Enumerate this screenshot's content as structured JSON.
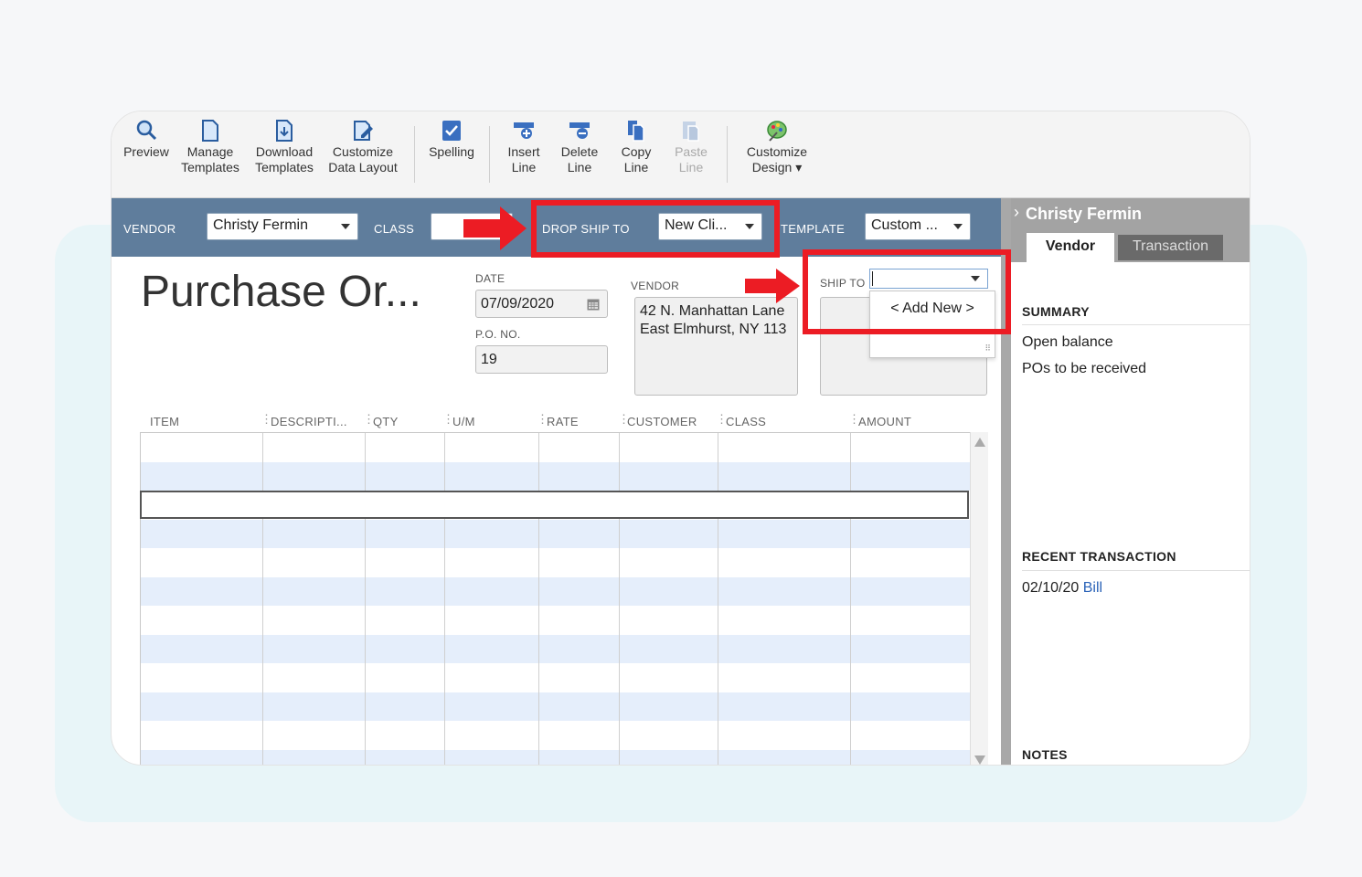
{
  "toolbar": {
    "preview": "Preview",
    "manage_1": "Manage",
    "manage_2": "Templates",
    "download_1": "Download",
    "download_2": "Templates",
    "customize_layout_1": "Customize",
    "customize_layout_2": "Data Layout",
    "spelling": "Spelling",
    "insert_1": "Insert",
    "insert_2": "Line",
    "delete_1": "Delete",
    "delete_2": "Line",
    "copy_1": "Copy",
    "copy_2": "Line",
    "paste_1": "Paste",
    "paste_2": "Line",
    "design_1": "Customize",
    "design_2": "Design ▾"
  },
  "header": {
    "vendor_label": "VENDOR",
    "vendor_value": "Christy Fermin",
    "class_label": "CLASS",
    "class_value": "",
    "drop_ship_label": "DROP SHIP TO",
    "drop_ship_value": "New Cli...",
    "template_label": "TEMPLATE",
    "template_value": "Custom ..."
  },
  "form": {
    "title": "Purchase Or...",
    "date_label": "DATE",
    "date_value": "07/09/2020",
    "po_label": "P.O. NO.",
    "po_value": "19",
    "vendor_label": "VENDOR",
    "vendor_address": [
      "42 N. Manhattan Lane",
      "East Elmhurst, NY 113"
    ],
    "ship_to_label": "SHIP TO",
    "ship_to_option": "< Add New >"
  },
  "grid": {
    "columns": [
      "ITEM",
      "DESCRIPTI...",
      "QTY",
      "U/M",
      "RATE",
      "CUSTOMER",
      "CLASS",
      "AMOUNT"
    ]
  },
  "sidepanel": {
    "name": "Christy Fermin",
    "tabs": [
      "Vendor",
      "Transaction"
    ],
    "summary_heading": "SUMMARY",
    "summary_items": [
      "Open balance",
      "POs to be received"
    ],
    "recent_heading": "RECENT TRANSACTION",
    "recent_date": "02/10/20",
    "recent_link": "Bill",
    "notes_heading": "NOTES"
  },
  "colors": {
    "header_bar": "#5f7d9c",
    "highlight_red": "#ec1c24",
    "row_alt": "#e5eefb",
    "link": "#2b63b8"
  }
}
